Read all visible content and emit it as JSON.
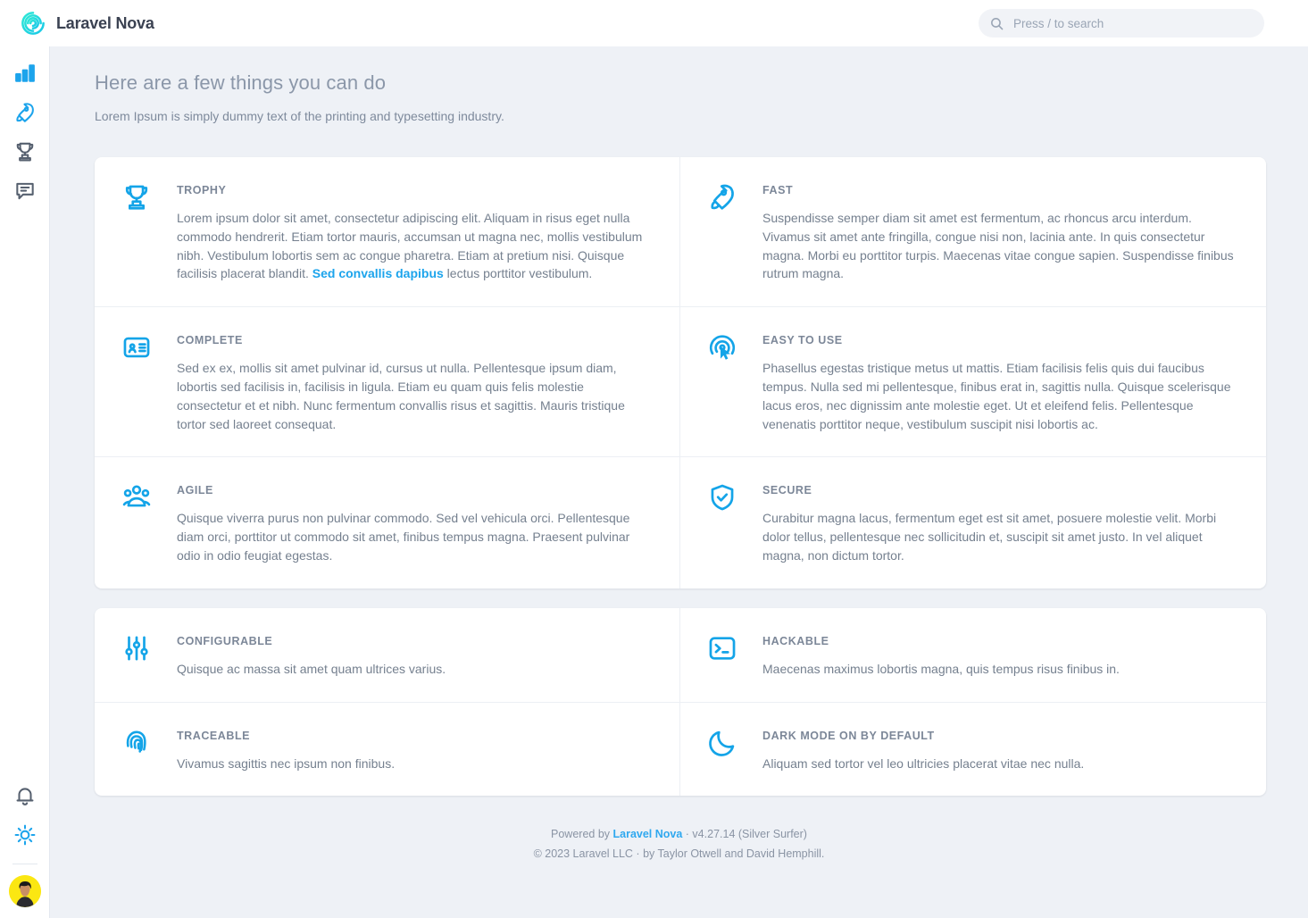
{
  "brand": {
    "name": "Laravel Nova",
    "logo_icon": "nova-spiral-logo"
  },
  "search": {
    "placeholder": "Press / to search",
    "value": "",
    "icon": "search-icon"
  },
  "sidebar": {
    "items": [
      {
        "icon": "bar-chart-icon",
        "name": "dashboard",
        "active": true
      },
      {
        "icon": "rocket-icon",
        "name": "rocket",
        "active": true
      },
      {
        "icon": "trophy-icon",
        "name": "trophy",
        "active": false
      },
      {
        "icon": "comment-icon",
        "name": "comments",
        "active": false
      }
    ],
    "bottom": [
      {
        "icon": "bell-icon",
        "name": "notifications",
        "active": false
      },
      {
        "icon": "sun-icon",
        "name": "theme-toggle",
        "active": true
      }
    ],
    "avatar_icon": "user-avatar"
  },
  "page": {
    "title": "Here are a few things you can do",
    "subtitle": "Lorem Ipsum is simply dummy text of the printing and typesetting industry."
  },
  "colors": {
    "accent": "#1ca4ec",
    "icon": "#14a4e8",
    "background": "#eef1f6",
    "card": "#ffffff",
    "title_text": "#8b97a9",
    "body_text": "#75808f",
    "avatar_bg": "#fbe712"
  },
  "primary_cards": [
    {
      "icon": "trophy-icon",
      "title": "TROPHY",
      "text_before": "Lorem ipsum dolor sit amet, consectetur adipiscing elit. Aliquam in risus eget nulla commodo hendrerit. Etiam tortor mauris, accumsan ut magna nec, mollis vestibulum nibh. Vestibulum lobortis sem ac congue pharetra. Etiam at pretium nisi. Quisque facilisis placerat blandit. ",
      "link": "Sed convallis dapibus",
      "text_after": " lectus porttitor vestibulum."
    },
    {
      "icon": "rocket-icon",
      "title": "FAST",
      "text": "Suspendisse semper diam sit amet est fermentum, ac rhoncus arcu interdum. Vivamus sit amet ante fringilla, congue nisi non, lacinia ante. In quis consectetur magna. Morbi eu porttitor turpis. Maecenas vitae congue sapien. Suspendisse finibus rutrum magna."
    },
    {
      "icon": "id-card-icon",
      "title": "COMPLETE",
      "text": "Sed ex ex, mollis sit amet pulvinar id, cursus ut nulla. Pellentesque ipsum diam, lobortis sed facilisis in, facilisis in ligula. Etiam eu quam quis felis molestie consectetur et et nibh. Nunc fermentum convallis risus et sagittis. Mauris tristique tortor sed laoreet consequat."
    },
    {
      "icon": "cursor-click-icon",
      "title": "EASY TO USE",
      "text": "Phasellus egestas tristique metus ut mattis. Etiam facilisis felis quis dui faucibus tempus. Nulla sed mi pellentesque, finibus erat in, sagittis nulla. Quisque scelerisque lacus eros, nec dignissim ante molestie eget. Ut et eleifend felis. Pellentesque venenatis porttitor neque, vestibulum suscipit nisi lobortis ac."
    },
    {
      "icon": "users-group-icon",
      "title": "AGILE",
      "text": "Quisque viverra purus non pulvinar commodo. Sed vel vehicula orci. Pellentesque diam orci, porttitor ut commodo sit amet, finibus tempus magna. Praesent pulvinar odio in odio feugiat egestas."
    },
    {
      "icon": "shield-check-icon",
      "title": "SECURE",
      "text": "Curabitur magna lacus, fermentum eget est sit amet, posuere molestie velit. Morbi dolor tellus, pellentesque nec sollicitudin et, suscipit sit amet justo. In vel aliquet magna, non dictum tortor."
    }
  ],
  "secondary_cards": [
    {
      "icon": "sliders-icon",
      "title": "CONFIGURABLE",
      "text": "Quisque ac massa sit amet quam ultrices varius."
    },
    {
      "icon": "terminal-icon",
      "title": "HACKABLE",
      "text": "Maecenas maximus lobortis magna, quis tempus risus finibus in."
    },
    {
      "icon": "fingerprint-icon",
      "title": "TRACEABLE",
      "text": "Vivamus sagittis nec ipsum non finibus."
    },
    {
      "icon": "moon-icon",
      "title": "DARK MODE ON BY DEFAULT",
      "text": "Aliquam sed tortor vel leo ultricies placerat vitae nec nulla."
    }
  ],
  "footer": {
    "powered_prefix": "Powered by ",
    "powered_link": "Laravel Nova",
    "version": " · v4.27.14 (Silver Surfer)",
    "copyright": "© 2023 Laravel LLC · by Taylor Otwell and David Hemphill."
  }
}
